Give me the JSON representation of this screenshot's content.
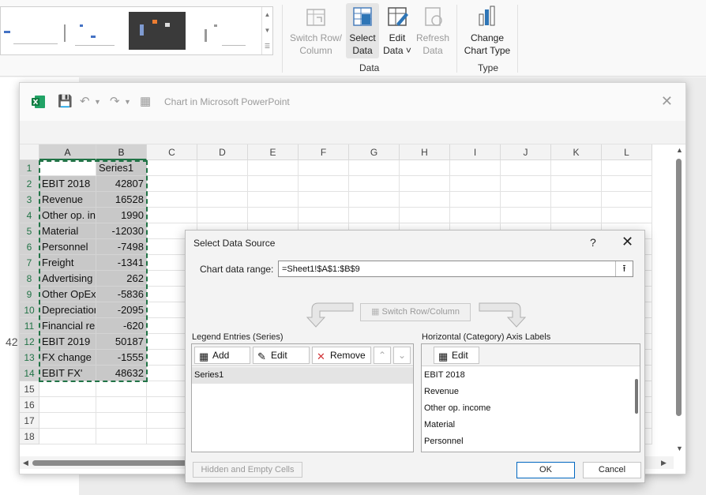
{
  "ribbon": {
    "buttons": {
      "switch_row_column": {
        "line1": "Switch Row/",
        "line2": "Column"
      },
      "select_data": {
        "line1": "Select",
        "line2": "Data"
      },
      "edit_data": {
        "line1": "Edit",
        "line2": "Data ˅"
      },
      "refresh_data": {
        "line1": "Refresh",
        "line2": "Data"
      },
      "change_chart_type": {
        "line1": "Change",
        "line2": "Chart Type"
      }
    },
    "groups": {
      "data": "Data",
      "type": "Type"
    }
  },
  "slide": {
    "partial_number": "42"
  },
  "excel": {
    "title": "Chart in Microsoft PowerPoint",
    "columns": [
      "A",
      "B",
      "C",
      "D",
      "E",
      "F",
      "G",
      "H",
      "I",
      "J",
      "K",
      "L"
    ],
    "row_numbers": [
      "1",
      "2",
      "3",
      "4",
      "5",
      "6",
      "7",
      "8",
      "9",
      "10",
      "11",
      "12",
      "13",
      "14",
      "15",
      "16",
      "17",
      "18"
    ],
    "cells": {
      "header_b": "Series1",
      "rows": [
        {
          "label": "EBIT 2018",
          "value": "42807"
        },
        {
          "label": "Revenue",
          "value": "16528"
        },
        {
          "label": "Other op. income",
          "value": "1990"
        },
        {
          "label": "Material",
          "value": "-12030"
        },
        {
          "label": "Personnel",
          "value": "-7498"
        },
        {
          "label": "Freight",
          "value": "-1341"
        },
        {
          "label": "Advertising",
          "value": "262"
        },
        {
          "label": "Other OpEx",
          "value": "-5836"
        },
        {
          "label": "Depreciation",
          "value": "-2095"
        },
        {
          "label": "Financial result",
          "value": "-620"
        },
        {
          "label": "EBIT 2019",
          "value": "50187"
        },
        {
          "label": "FX change",
          "value": "-1555"
        },
        {
          "label": "EBIT FX'",
          "value": "48632"
        }
      ]
    }
  },
  "dialog": {
    "title": "Select Data Source",
    "help": "?",
    "close": "✕",
    "range_label": "Chart data range:",
    "range_value": "=Sheet1!$A$1:$B$9",
    "switch_label": "Switch Row/Column",
    "legend_label": "Legend Entries (Series)",
    "legend_buttons": {
      "add": "Add",
      "edit": "Edit",
      "remove": "Remove"
    },
    "series": [
      "Series1"
    ],
    "axis_label": "Horizontal (Category) Axis Labels",
    "axis_edit": "Edit",
    "axis_items": [
      "EBIT 2018",
      "Revenue",
      "Other op. income",
      "Material",
      "Personnel"
    ],
    "hidden_cells": "Hidden and Empty Cells",
    "ok": "OK",
    "cancel": "Cancel"
  }
}
